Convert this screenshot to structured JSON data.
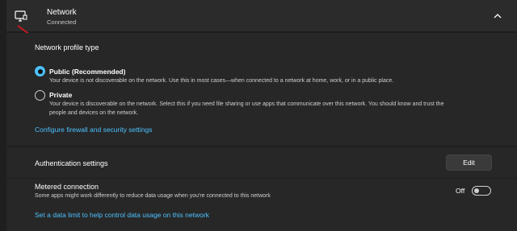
{
  "header": {
    "title": "Network",
    "status": "Connected",
    "icon": "network-monitor-icon",
    "chevron": "chevron-up-icon"
  },
  "profile": {
    "section_label": "Network profile type",
    "options": [
      {
        "title": "Public (Recommended)",
        "description": "Your device is not discoverable on the network. Use this in most cases—when connected to a network at home, work, or in a public place.",
        "selected": true
      },
      {
        "title": "Private",
        "description_line1": "Your device is discoverable on the network. Select this if you need file sharing or use apps that communicate over this network. You should know and trust the",
        "description_line2": "people and devices on the network.",
        "selected": false
      }
    ],
    "firewall_link": "Configure firewall and security settings"
  },
  "authentication": {
    "title": "Authentication settings",
    "button": "Edit"
  },
  "metered": {
    "title": "Metered connection",
    "description": "Some apps might work differently to reduce data usage when you're connected to this network",
    "toggle_label": "Off",
    "toggle_on": false,
    "data_limit_link": "Set a data limit to help control data usage on this network"
  },
  "colors": {
    "accent": "#4cc2ff",
    "annotation_arrow": "#d0191c"
  }
}
